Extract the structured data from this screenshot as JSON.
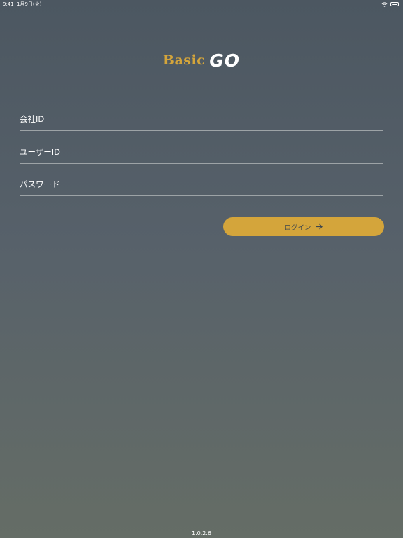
{
  "status_bar": {
    "time": "9:41",
    "date": "1月9日(火)",
    "battery_level": 1.0
  },
  "logo": {
    "basic_text": "Basic",
    "go_text": "GO"
  },
  "form": {
    "company_id_placeholder": "会社ID",
    "user_id_placeholder": "ユーザーID",
    "password_placeholder": "パスワード"
  },
  "login_button": {
    "label": "ログイン",
    "icon": "arrow-right-icon"
  },
  "footer": {
    "version": "1.0.2.6"
  },
  "colors": {
    "accent": "#d4a53b",
    "background_top": "#4c5761",
    "background_bottom": "#656d66",
    "button_text": "#3e464d"
  }
}
